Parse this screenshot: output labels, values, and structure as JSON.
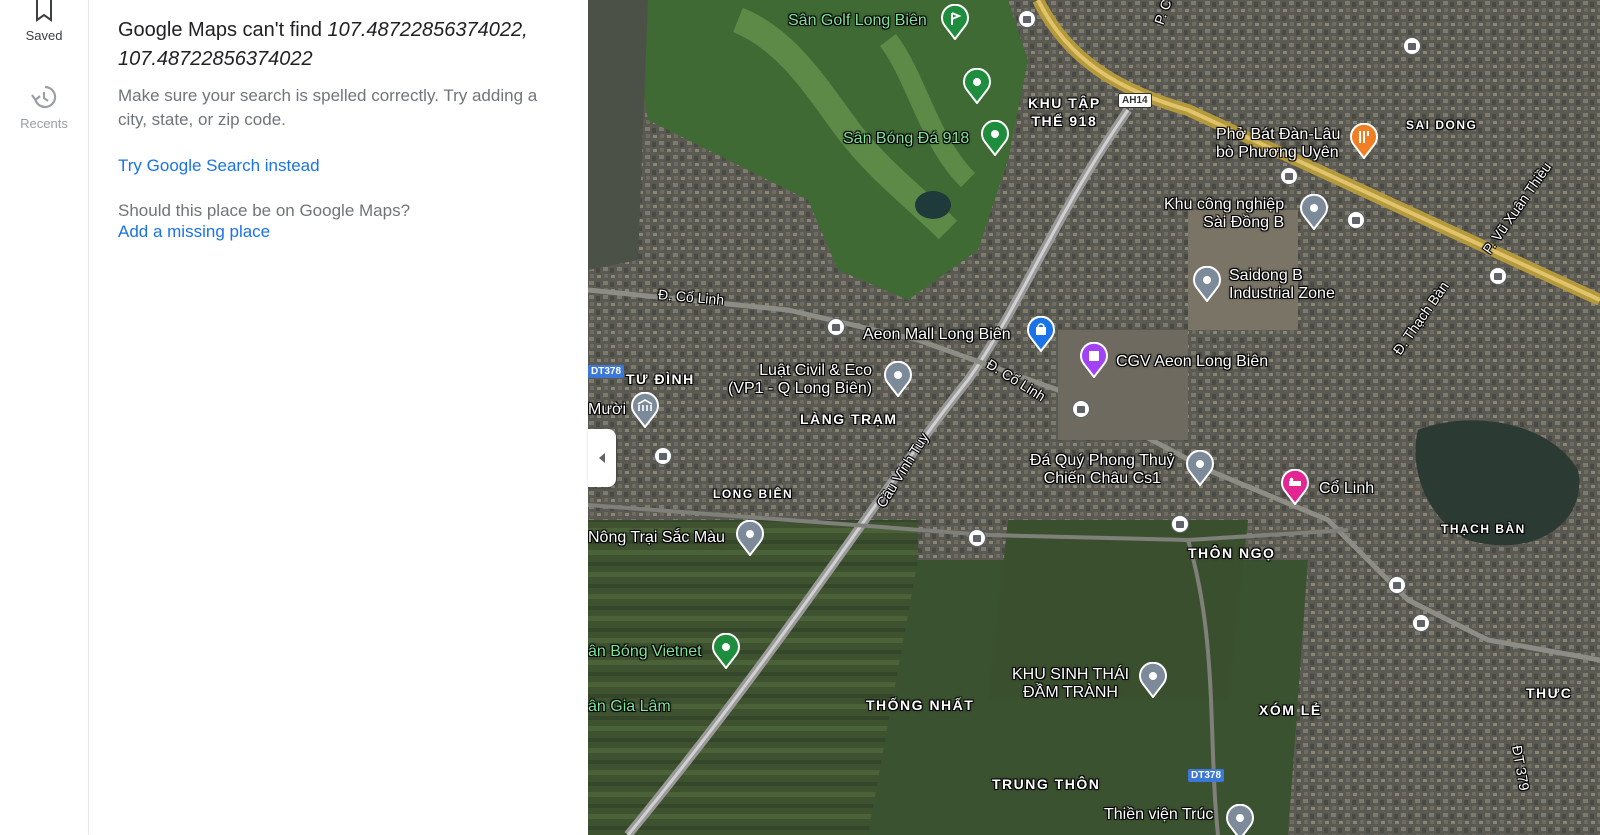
{
  "rail": {
    "saved": "Saved",
    "recents": "Recents"
  },
  "panel": {
    "title_prefix": "Google Maps can't find ",
    "query": "107.48722856374022, 107.48722856374022",
    "hint": "Make sure your search is spelled correctly. Try adding a city, state, or zip code.",
    "google_search_link": "Try Google Search instead",
    "question": "Should this place be on Google Maps?",
    "add_place_link": "Add a missing place"
  },
  "map": {
    "places": {
      "golf": "Sân Golf Long Biên",
      "football918": "Sân Bóng Đá 918",
      "pho": "Phở Bát Đàn-Lâu\nbò Phương Uyên",
      "ktx": "Khu công nghiệp\nSài Đồng B",
      "saidong": "Saidong B\nIndustrial Zone",
      "aeon": "Aeon Mall Long Biên",
      "cgv": "CGV Aeon Long Biên",
      "luat": "Luật Civil & Eco\n(VP1 - Q Long Biên)",
      "muoi": "Mười",
      "daquy": "Đá Quý Phong Thuỷ\nChiến Châu Cs1",
      "colinh_hotel": "Cổ Linh",
      "nongtrai": "Nông Trại Sắc Màu",
      "bongvietnet": "ân Bóng Vietnet",
      "sinhthai": "KHU SINH THÁI\nĐẦM TRÀNH",
      "giatlam": "ân Gia Lâm",
      "thienvien": "Thiền viện Trúc"
    },
    "areas": {
      "khutapthe": "KHU TẬP\nTHỂ 918",
      "saidong": "SAI DONG",
      "tudinh": "TƯ ĐÌNH",
      "langtram": "LÀNG TRẠM",
      "longbien": "LONG BIÊN",
      "thonngo": "THÔN NGỌ",
      "thachban": "THẠCH BÀN",
      "thongnhat": "THỐNG NHẤT",
      "xomle": "XÓM LẺ",
      "trungthon": "TRUNG THÔN",
      "thuc": "THƯC"
    },
    "roads": {
      "colinh1": "Đ. Cổ Linh",
      "colinh2": "Đ. Cổ Linh",
      "vinhtuy": "Cầu Vĩnh Tuy",
      "thachban": "Đ. Thạch Bàn",
      "vuxuanthieu": "P. Vũ Xuân Thiều",
      "dt379": "ĐT 379",
      "pc": "P. C"
    },
    "badges": {
      "ah14": "AH14",
      "dt378a": "DT378",
      "dt378b": "DT378"
    },
    "colors": {
      "green_pin": "#1e8e3e",
      "grey_pin": "#7d8a99",
      "blue_pin": "#1a73e8",
      "purple_pin": "#a142f4",
      "orange_pin": "#f07e23",
      "pink_pin": "#e52592"
    }
  }
}
